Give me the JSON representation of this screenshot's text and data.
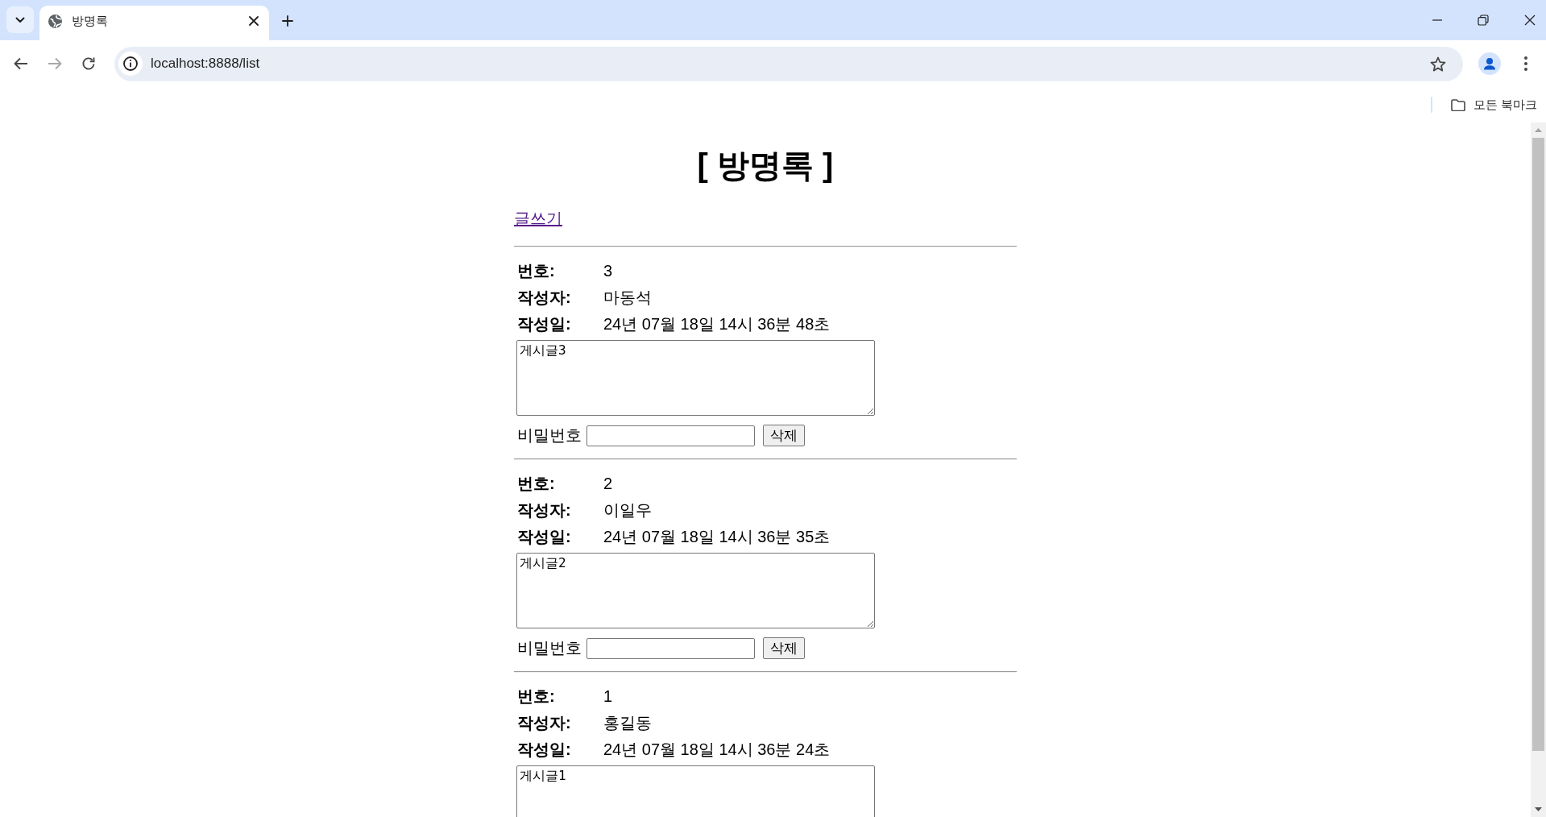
{
  "browser": {
    "tabs": [
      {
        "title": "방명록",
        "selected": true
      }
    ],
    "forward": {
      "disabled": true
    },
    "address": "localhost:8888/list",
    "bookmarks": {
      "folder": "모든 북마크"
    }
  },
  "page": {
    "title": "[ 방명록 ]",
    "write_link": "글쓰기",
    "entries": [
      {
        "fields": [
          {
            "label": "번호:",
            "value": "3"
          },
          {
            "label": "작성자:",
            "value": "마동석"
          },
          {
            "label": "작성일:",
            "value": "24년 07월 18일 14시 36분 48초"
          }
        ],
        "content": "게시글3",
        "password_label": "비밀번호",
        "delete_button": "삭제"
      },
      {
        "fields": [
          {
            "label": "번호:",
            "value": "2"
          },
          {
            "label": "작성자:",
            "value": "이일우"
          },
          {
            "label": "작성일:",
            "value": "24년 07월 18일 14시 36분 35초"
          }
        ],
        "content": "게시글2",
        "password_label": "비밀번호",
        "delete_button": "삭제"
      },
      {
        "fields": [
          {
            "label": "번호:",
            "value": "1"
          },
          {
            "label": "작성자:",
            "value": "홍길동"
          },
          {
            "label": "작성일:",
            "value": "24년 07월 18일 14시 36분 24초"
          }
        ],
        "content": "게시글1"
      }
    ]
  }
}
